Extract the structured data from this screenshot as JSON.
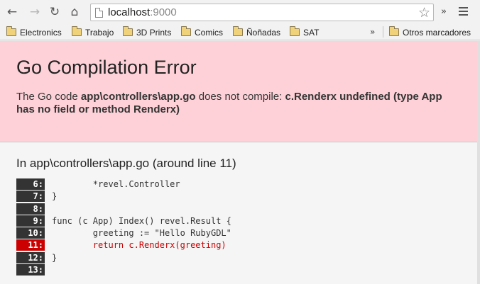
{
  "browser": {
    "url_host": "localhost",
    "url_port": ":9000",
    "ext_overflow": "»",
    "nav_icons": [
      "back-arrow-icon",
      "forward-arrow-icon",
      "reload-icon",
      "home-icon"
    ]
  },
  "bookmarks": {
    "items": [
      "Electronics",
      "Trabajo",
      "3D Prints",
      "Comics",
      "Ñoñadas",
      "SAT"
    ],
    "overflow": "»",
    "other": "Otros marcadores"
  },
  "error": {
    "title": "Go Compilation Error",
    "desc_prefix": "The Go code ",
    "file": "app\\controllers\\app.go",
    "desc_middle": " does not compile: ",
    "message": "c.Renderx undefined (type App has no field or method Renderx)"
  },
  "source": {
    "heading": "In app\\controllers\\app.go (around line 11)",
    "lines": [
      {
        "num": "6:",
        "code": "        *revel.Controller",
        "error": false
      },
      {
        "num": "7:",
        "code": "}",
        "error": false
      },
      {
        "num": "8:",
        "code": "",
        "error": false
      },
      {
        "num": "9:",
        "code": "func (c App) Index() revel.Result {",
        "error": false
      },
      {
        "num": "10:",
        "code": "        greeting := \"Hello RubyGDL\"",
        "error": false
      },
      {
        "num": "11:",
        "code": "        return c.Renderx(greeting)",
        "error": true
      },
      {
        "num": "12:",
        "code": "}",
        "error": false
      },
      {
        "num": "13:",
        "code": "",
        "error": false
      }
    ]
  },
  "colors": {
    "banner_bg": "#fdd1d7",
    "error_red": "#cc0000",
    "line_num_bg": "#333333"
  }
}
